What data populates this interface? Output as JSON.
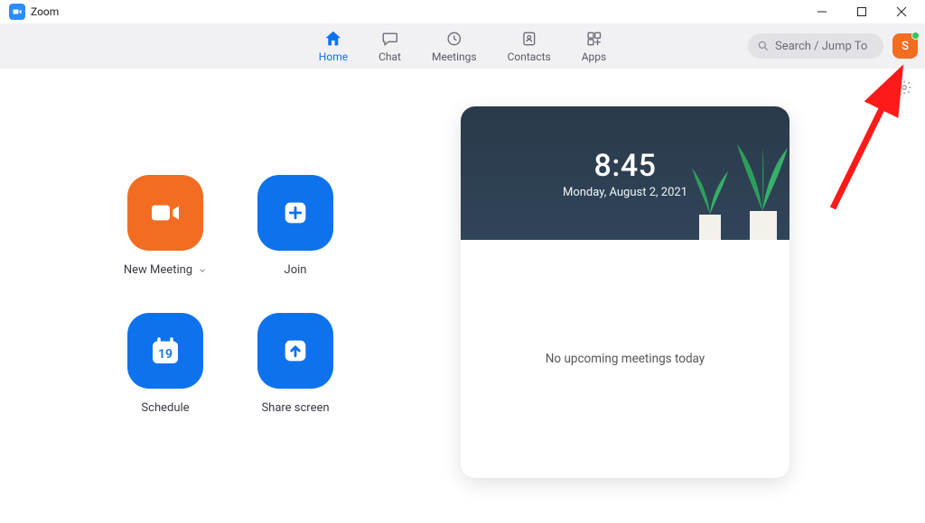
{
  "titlebar": {
    "app_name": "Zoom"
  },
  "nav": {
    "home": "Home",
    "chat": "Chat",
    "meetings": "Meetings",
    "contacts": "Contacts",
    "apps": "Apps"
  },
  "search": {
    "placeholder": "Search / Jump To"
  },
  "avatar": {
    "initial": "S"
  },
  "actions": {
    "new_meeting": "New Meeting",
    "join": "Join",
    "schedule": "Schedule",
    "schedule_day": "19",
    "share_screen": "Share screen"
  },
  "card": {
    "time": "8:45",
    "date": "Monday, August 2, 2021",
    "empty_state": "No upcoming meetings today"
  }
}
